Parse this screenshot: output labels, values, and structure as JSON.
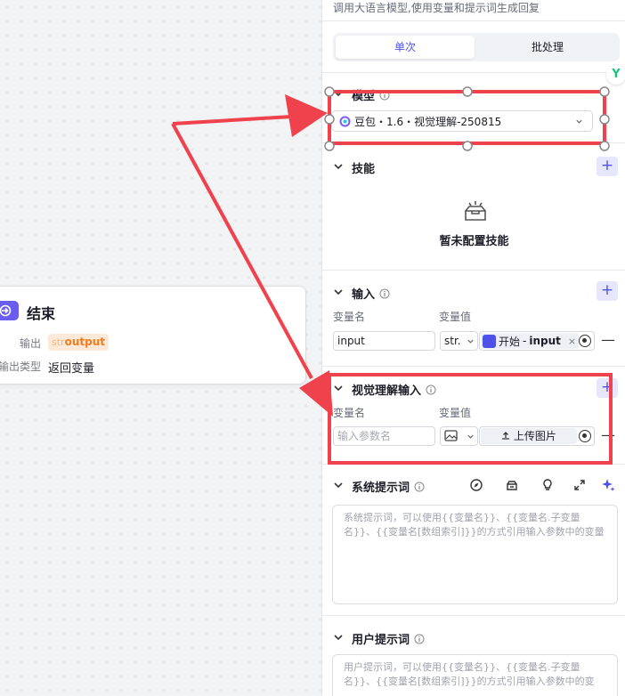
{
  "canvas": {
    "end_node": {
      "title": "结束",
      "output_label": "输出",
      "output_type_tag": "str",
      "output_var": "output",
      "output_type_label": "输出类型",
      "output_type_value": "返回变量"
    }
  },
  "panel": {
    "description": "调用大语言模型,使用变量和提示词生成回复",
    "tabs": {
      "single": "单次",
      "batch": "批处理"
    },
    "model": {
      "title": "模型",
      "selected": "豆包・1.6・视觉理解-250815"
    },
    "skills": {
      "title": "技能",
      "empty": "暂未配置技能"
    },
    "inputs": {
      "title": "输入",
      "col_name": "变量名",
      "col_value": "变量值",
      "row_name": "input",
      "row_type": "str.",
      "ref_source": "开始",
      "ref_sep": "-",
      "ref_var": "input"
    },
    "vision": {
      "title": "视觉理解输入",
      "col_name": "变量名",
      "col_value": "变量值",
      "name_placeholder": "输入参数名",
      "upload_label": "上传图片"
    },
    "system_prompt": {
      "title": "系统提示词",
      "placeholder": "系统提示词，可以使用{{变量名}}、{{变量名.子变量名}}、{{变量名[数组索引]}}的方式引用输入参数中的变量"
    },
    "user_prompt": {
      "title": "用户提示词",
      "placeholder": "用户提示词，可以使用{{变量名}}、{{变量名.子变量名}}、{{变量名[数组索引]}}的方式引用输入参数中的变"
    }
  },
  "colors": {
    "accent": "#4d53e8",
    "highlight": "#f0424c",
    "output_tag": "#f07c20"
  }
}
